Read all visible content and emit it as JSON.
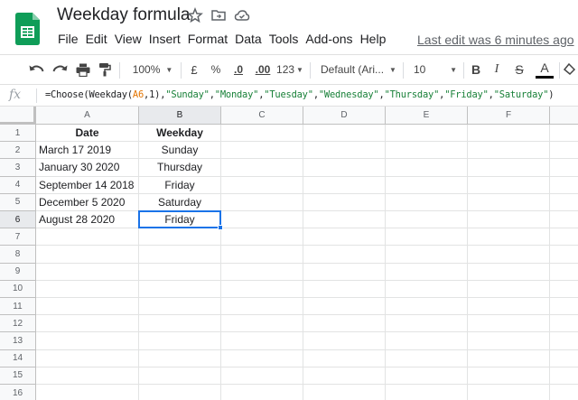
{
  "doc": {
    "title": "Weekday formula",
    "menu": [
      "File",
      "Edit",
      "View",
      "Insert",
      "Format",
      "Data",
      "Tools",
      "Add-ons",
      "Help"
    ],
    "last_edit": "Last edit was 6 minutes ago"
  },
  "toolbar": {
    "zoom": "100%",
    "currency": "£",
    "percent": "%",
    "dec_decrease": ".0",
    "dec_increase": ".00",
    "more_formats": "123",
    "font": "Default (Ari...",
    "font_size": "10",
    "bold": "B",
    "italic": "I",
    "strike": "S",
    "text_color": "A"
  },
  "formula_bar": {
    "fx": "fx",
    "parts": [
      {
        "t": "=Choose(Weekday(",
        "k": "plain"
      },
      {
        "t": "A6",
        "k": "ref"
      },
      {
        "t": ",1),",
        "k": "plain"
      },
      {
        "t": "\"Sunday\"",
        "k": "str"
      },
      {
        "t": ",",
        "k": "plain"
      },
      {
        "t": "\"Monday\"",
        "k": "str"
      },
      {
        "t": ",",
        "k": "plain"
      },
      {
        "t": "\"Tuesday\"",
        "k": "str"
      },
      {
        "t": ",",
        "k": "plain"
      },
      {
        "t": "\"Wednesday\"",
        "k": "str"
      },
      {
        "t": ",",
        "k": "plain"
      },
      {
        "t": "\"Thursday\"",
        "k": "str"
      },
      {
        "t": ",",
        "k": "plain"
      },
      {
        "t": "\"Friday\"",
        "k": "str"
      },
      {
        "t": ",",
        "k": "plain"
      },
      {
        "t": "\"Saturday\"",
        "k": "str"
      },
      {
        "t": ")",
        "k": "plain"
      }
    ]
  },
  "sheet": {
    "columns": [
      "A",
      "B",
      "C",
      "D",
      "E",
      "F"
    ],
    "rows": [
      "1",
      "2",
      "3",
      "4",
      "5",
      "6",
      "7",
      "8",
      "9",
      "10",
      "11",
      "12",
      "13",
      "14",
      "15",
      "16"
    ],
    "selected_col": "B",
    "selected_row": "6",
    "cells": [
      [
        "Date",
        "Weekday"
      ],
      [
        "March 17 2019",
        "Sunday"
      ],
      [
        "January 30 2020",
        "Thursday"
      ],
      [
        "September 14 2018",
        "Friday"
      ],
      [
        "December 5 2020",
        "Saturday"
      ],
      [
        "August 28 2020",
        "Friday"
      ]
    ]
  },
  "colors": {
    "sheets_green": "#0f9d58",
    "accent_blue": "#1a73e8",
    "ref_orange": "#e37400",
    "string_green": "#188038"
  },
  "icons": [
    "sheets-logo-icon",
    "star-icon",
    "move-to-folder-icon",
    "cloud-saved-icon",
    "undo-icon",
    "redo-icon",
    "print-icon",
    "paint-format-icon",
    "text-color-icon",
    "fill-color-icon"
  ]
}
